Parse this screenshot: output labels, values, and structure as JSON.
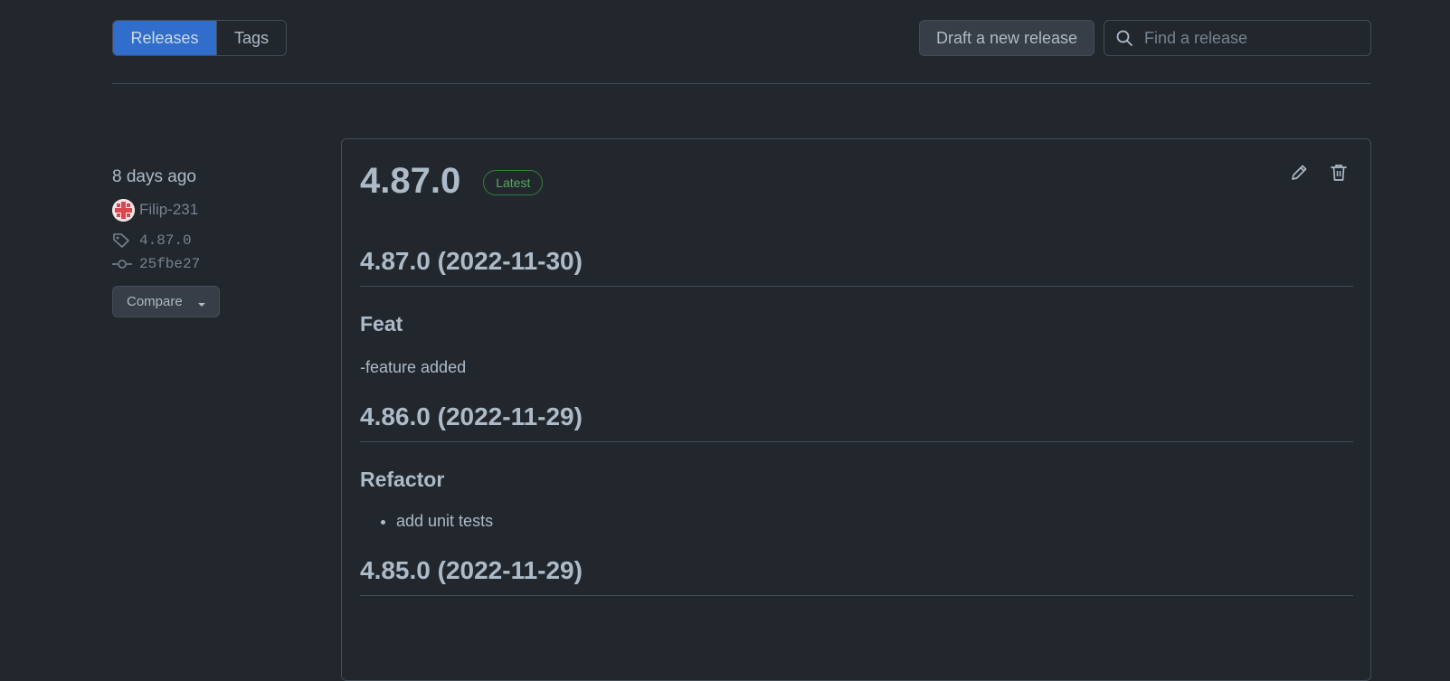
{
  "subnav": {
    "releases_label": "Releases",
    "tags_label": "Tags"
  },
  "toolbar": {
    "draft_label": "Draft a new release",
    "search_placeholder": "Find a release"
  },
  "release": {
    "time_ago": "8 days ago",
    "author": "Filip-231",
    "tag": "4.87.0",
    "commit": "25fbe27",
    "compare_label": "Compare",
    "title": "4.87.0",
    "badge": "Latest",
    "notes": {
      "h1": "4.87.0 (2022-11-30)",
      "h1_section": "Feat",
      "h1_text": "-feature added",
      "h2": "4.86.0 (2022-11-29)",
      "h2_section": "Refactor",
      "h2_item": "add unit tests",
      "h3": "4.85.0 (2022-11-29)"
    }
  },
  "colors": {
    "background": "#22272e",
    "accent": "#316dca",
    "border": "#444c56",
    "latest_green": "#57ab5a"
  }
}
